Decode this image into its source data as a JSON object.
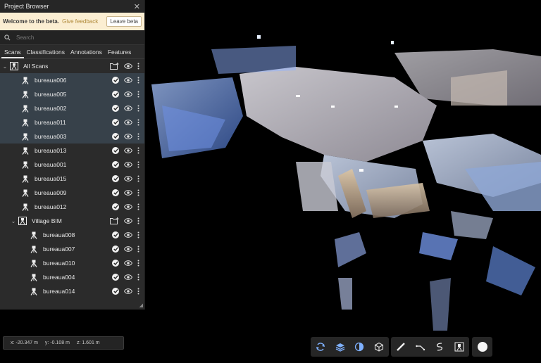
{
  "panel": {
    "title": "Project Browser",
    "beta": {
      "welcome": "Welcome to the beta.",
      "feedback": "Give feedback",
      "leave": "Leave beta"
    },
    "search_placeholder": "Search",
    "tabs": [
      "Scans",
      "Classifications",
      "Annotations",
      "Features"
    ],
    "tree": {
      "root_label": "All Scans",
      "scans": [
        {
          "name": "bureaua006",
          "selected": true
        },
        {
          "name": "bureaua005",
          "selected": true
        },
        {
          "name": "bureaua002",
          "selected": true
        },
        {
          "name": "bureaua011",
          "selected": true
        },
        {
          "name": "bureaua003",
          "selected": true
        },
        {
          "name": "bureaua013",
          "selected": false
        },
        {
          "name": "bureaua001",
          "selected": false
        },
        {
          "name": "bureaua015",
          "selected": false
        },
        {
          "name": "bureaua009",
          "selected": false
        },
        {
          "name": "bureaua012",
          "selected": false
        }
      ],
      "group_label": "Village BIM",
      "group_scans": [
        "bureaua008",
        "bureaua007",
        "bureaua010",
        "bureaua004",
        "bureaua014"
      ]
    }
  },
  "coords": {
    "x": "x: -20.347 m",
    "y": "y: -0.108 m",
    "z": "z: 1.601 m"
  },
  "toolbar": {
    "view_tools": [
      "orbit-icon",
      "layers-icon",
      "shading-icon",
      "cube-icon"
    ],
    "measure_tools": [
      "ruler-icon",
      "angle-measure-icon",
      "path-icon",
      "scan-station-icon"
    ]
  },
  "colors": {
    "beta_bg": "#fbeed2",
    "accent_link": "#b08a3a",
    "selection": "#37414a"
  }
}
